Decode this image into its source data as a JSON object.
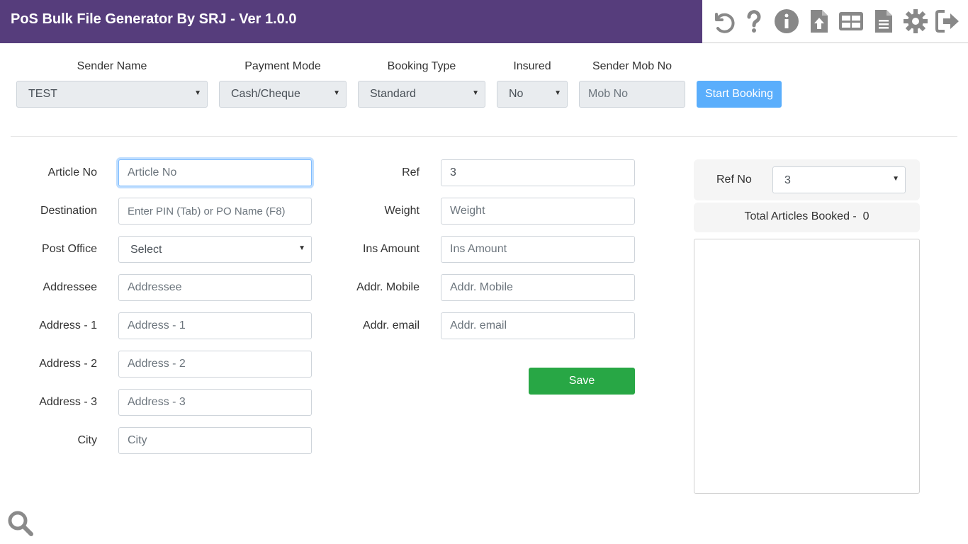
{
  "app": {
    "title": "PoS Bulk File Generator By SRJ - Ver 1.0.0"
  },
  "toolbar": {
    "icons": [
      "undo-icon",
      "help-icon",
      "info-icon",
      "upload-file-icon",
      "table-icon",
      "document-icon",
      "gear-icon",
      "logout-icon"
    ],
    "icon_color": "#888888"
  },
  "booking": {
    "sender_name_label": "Sender Name",
    "sender_name_value": "TEST",
    "payment_mode_label": "Payment Mode",
    "payment_mode_value": "Cash/Cheque",
    "booking_type_label": "Booking Type",
    "booking_type_value": "Standard",
    "insured_label": "Insured",
    "insured_value": "No",
    "sender_mob_label": "Sender Mob No",
    "sender_mob_placeholder": "Mob No",
    "start_button": "Start Booking"
  },
  "form": {
    "article_no_label": "Article No",
    "article_no_placeholder": "Article No",
    "destination_label": "Destination",
    "destination_placeholder": "Enter PIN (Tab) or PO Name (F8)",
    "post_office_label": "Post Office",
    "post_office_value": "Select",
    "addressee_label": "Addressee",
    "addressee_placeholder": "Addressee",
    "address1_label": "Address - 1",
    "address1_placeholder": "Address - 1",
    "address2_label": "Address - 2",
    "address2_placeholder": "Address - 2",
    "address3_label": "Address - 3",
    "address3_placeholder": "Address - 3",
    "city_label": "City",
    "city_placeholder": "City",
    "ref_label": "Ref",
    "ref_value": "3",
    "weight_label": "Weight",
    "weight_placeholder": "Weight",
    "ins_amount_label": "Ins Amount",
    "ins_amount_placeholder": "Ins Amount",
    "addr_mobile_label": "Addr. Mobile",
    "addr_mobile_placeholder": "Addr. Mobile",
    "addr_email_label": "Addr. email",
    "addr_email_placeholder": "Addr. email",
    "save_button": "Save"
  },
  "panel": {
    "ref_no_label": "Ref No",
    "ref_no_value": "3",
    "total_label": "Total Articles Booked -",
    "total_value": "0"
  },
  "colors": {
    "header_bg": "#563d7c",
    "start_button": "#5aaefc",
    "save_button": "#28a745"
  }
}
